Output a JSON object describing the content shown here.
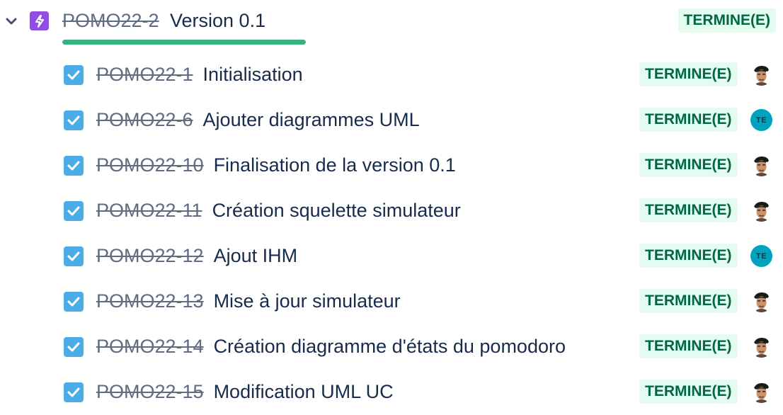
{
  "epic": {
    "key": "POMO22-2",
    "summary": "Version 0.1",
    "status": "TERMINE(E)",
    "progress_percent": 100,
    "icon": "lightning-icon",
    "color": "#904ee2"
  },
  "children": [
    {
      "key": "POMO22-1",
      "summary": "Initialisation",
      "status": "TERMINE(E)",
      "assignee": {
        "type": "photo"
      }
    },
    {
      "key": "POMO22-6",
      "summary": "Ajouter diagrammes UML",
      "status": "TERMINE(E)",
      "assignee": {
        "type": "initials",
        "initials": "TE"
      }
    },
    {
      "key": "POMO22-10",
      "summary": "Finalisation de la version 0.1",
      "status": "TERMINE(E)",
      "assignee": {
        "type": "photo"
      }
    },
    {
      "key": "POMO22-11",
      "summary": "Création squelette simulateur",
      "status": "TERMINE(E)",
      "assignee": {
        "type": "photo"
      }
    },
    {
      "key": "POMO22-12",
      "summary": "Ajout IHM",
      "status": "TERMINE(E)",
      "assignee": {
        "type": "initials",
        "initials": "TE"
      }
    },
    {
      "key": "POMO22-13",
      "summary": "Mise à jour simulateur",
      "status": "TERMINE(E)",
      "assignee": {
        "type": "photo"
      }
    },
    {
      "key": "POMO22-14",
      "summary": "Création diagramme d'états du pomodoro",
      "status": "TERMINE(E)",
      "assignee": {
        "type": "photo"
      }
    },
    {
      "key": "POMO22-15",
      "summary": "Modification UML UC",
      "status": "TERMINE(E)",
      "assignee": {
        "type": "photo"
      }
    }
  ],
  "colors": {
    "status_bg": "#e3fcef",
    "status_text": "#006644",
    "checkbox": "#4bade8",
    "progress": "#36b37e",
    "avatar_initials_bg": "#00a3bf"
  }
}
